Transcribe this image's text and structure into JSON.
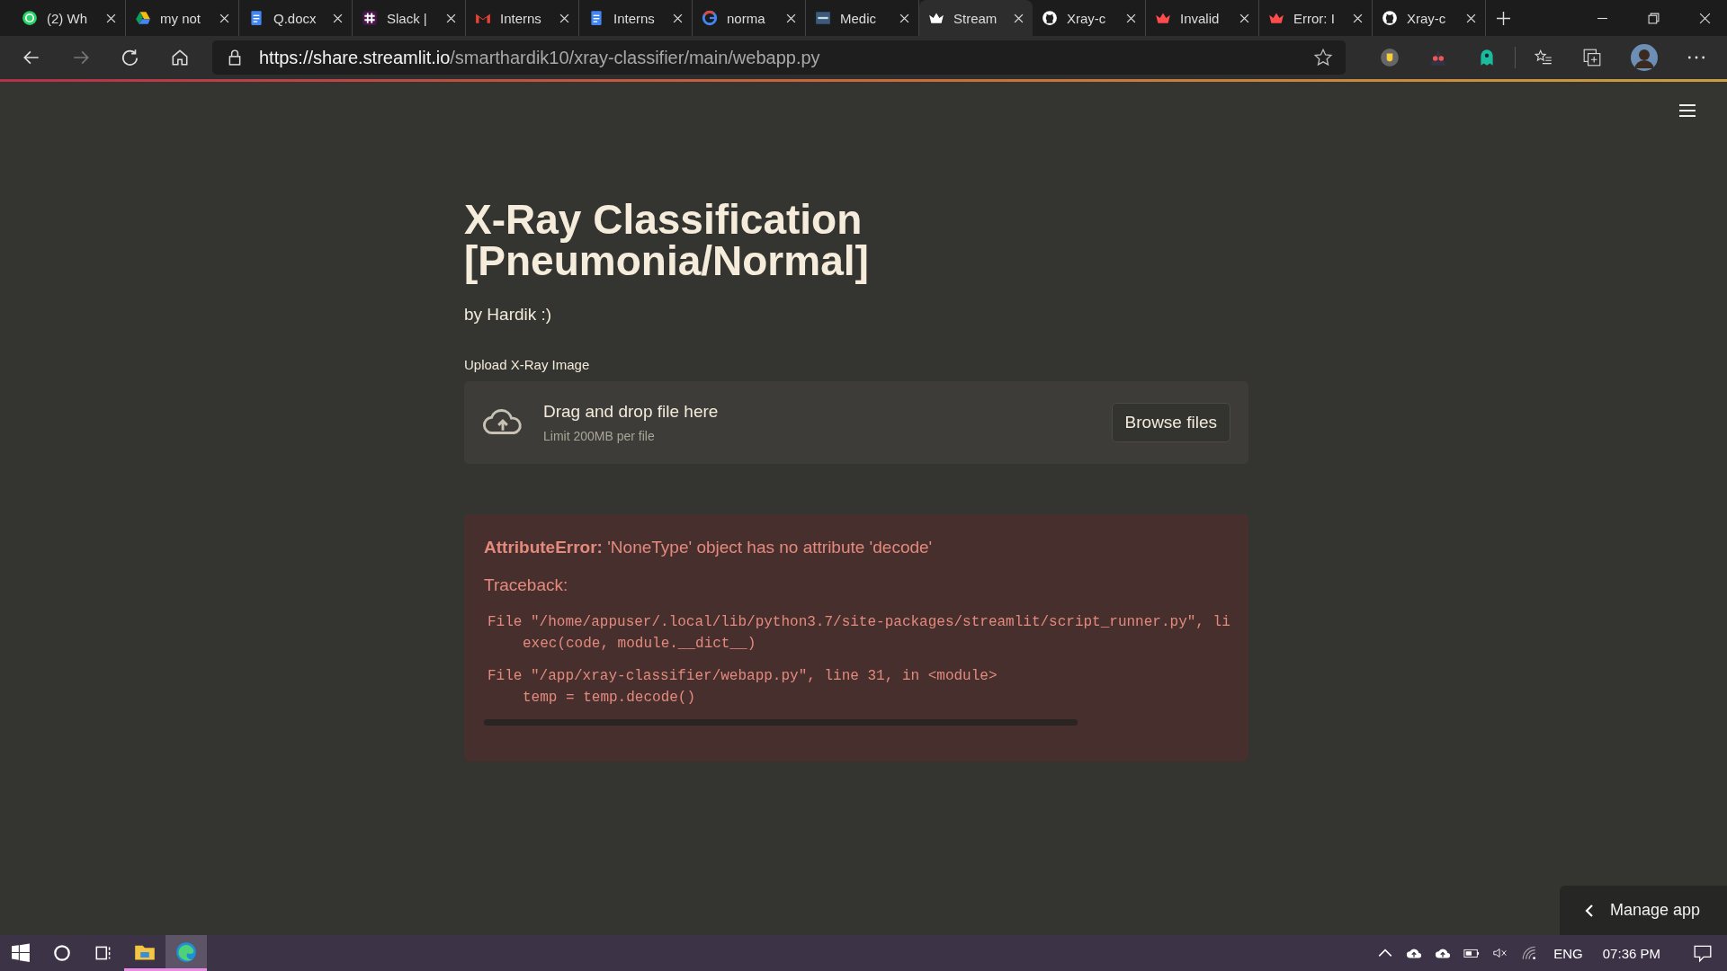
{
  "tabs": [
    {
      "kind": "whatsapp",
      "label": "(2) Wh",
      "selected": false
    },
    {
      "kind": "drive",
      "label": "my not",
      "selected": false
    },
    {
      "kind": "docs",
      "label": "Q.docx",
      "selected": false
    },
    {
      "kind": "slack",
      "label": "Slack |",
      "selected": false
    },
    {
      "kind": "gmail",
      "label": "Interns",
      "selected": false
    },
    {
      "kind": "docs",
      "label": "Interns",
      "selected": false
    },
    {
      "kind": "google",
      "label": "norma",
      "selected": false
    },
    {
      "kind": "tds",
      "label": "Medic",
      "selected": false
    },
    {
      "kind": "streamlit",
      "label": "Stream",
      "selected": true
    },
    {
      "kind": "github",
      "label": "Xray-c",
      "selected": false
    },
    {
      "kind": "streamlit",
      "label": "Invalid",
      "selected": false
    },
    {
      "kind": "streamlit",
      "label": "Error: I",
      "selected": false
    },
    {
      "kind": "github",
      "label": "Xray-c",
      "selected": false
    }
  ],
  "address_bar": {
    "host": "https://share.streamlit.io",
    "path": "/smarthardik10/xray-classifier/main/webapp.py"
  },
  "page": {
    "title": "X-Ray Classification [Pneumonia/Normal]",
    "subtitle": "by Hardik :)",
    "uploader": {
      "label": "Upload X-Ray Image",
      "prompt": "Drag and drop file here",
      "limit": "Limit 200MB per file",
      "button": "Browse files"
    },
    "error": {
      "type": "AttributeError:",
      "message": "'NoneType' object has no attribute 'decode'",
      "traceback_label": "Traceback:",
      "frames": [
        {
          "file": "File \"/home/appuser/.local/lib/python3.7/site-packages/streamlit/script_runner.py\", li",
          "code": "exec(code, module.__dict__)"
        },
        {
          "file": "File \"/app/xray-classifier/webapp.py\", line 31, in <module>",
          "code": "temp = temp.decode()"
        }
      ]
    },
    "manage_app": "Manage app"
  },
  "taskbar": {
    "apps": [
      {
        "kind": "explorer",
        "selected": false
      },
      {
        "kind": "edge",
        "selected": true
      }
    ],
    "language": "ENG",
    "time": "07:36 PM"
  }
}
